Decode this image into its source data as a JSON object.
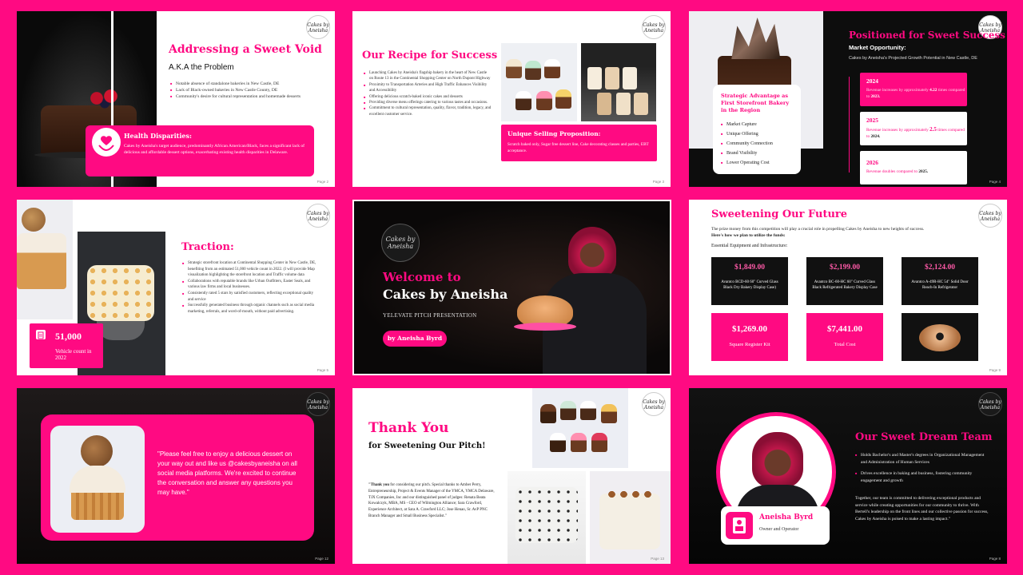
{
  "s1": {
    "title": "Addressing a Sweet Void",
    "subtitle": "A.K.A the Problem",
    "bullets": [
      "Notable absence of standalone bakeries in New Castle, DE",
      "Lack of Black-owned bakeries in New Castle County, DE",
      "Community's desire for cultural representation and homemade desserts"
    ],
    "callout_title": "Health Disparities:",
    "callout_text": "Cakes by Aneisha's target audience, predominantly African American/Black, faces a significant lack of delicious and affordable dessert options, exacerbating existing health disparities in Delaware.",
    "page": "Page 2"
  },
  "s2": {
    "title": "Our Recipe for Success",
    "bullets": [
      "Launching Cakes by Aneisha's flagship bakery in the heart of New Castle on Route 13 in the Continental Shopping Center on North Dupont Highway",
      "Proximity to Transportation Arteries and High Traffic Enhances Visibility and Accessibility",
      "Offering delicious scratch-baked iconic cakes and desserts",
      "Providing diverse menu offerings catering to various tastes and occasions.",
      "Commitment to cultural representation, quality, flavor, tradition, legacy, and excellent customer service."
    ],
    "usp_title": "Unique Selling Proposition:",
    "usp_text": "Scratch baked only, Sugar free dessert line, Cake decorating classes and parties, EBT acceptance.",
    "page": "Page 3"
  },
  "s3": {
    "title": "Positioned for Sweet Success",
    "market": "Market Opportunity:",
    "projection": "Cakes by Aneisha's Projected Growth Potential in New Castle, DE",
    "card_title": "Strategic Advantage as First Storefront Bakery in the Region",
    "card_items": [
      "Market Capture",
      "Unique Offering",
      "Community Connection",
      "Brand Visibility",
      "Lower Operating Cost"
    ],
    "timeline": [
      {
        "year": "2024",
        "pre": "Revenue increases by approximately ",
        "bold": "4.22",
        "post": " times compared to ",
        "ref": "2023."
      },
      {
        "year": "2025",
        "pre": "Revenue increases by approximately ",
        "bold": "2.5",
        "post": " times compared to ",
        "ref": "2024."
      },
      {
        "year": "2026",
        "pre": "Revenue doubles compared to ",
        "bold": "",
        "post": "",
        "ref": "2025."
      }
    ],
    "page": "Page 4"
  },
  "s4": {
    "title": "Traction:",
    "bullets": [
      "Strategic storefront location at Continental Shopping Center in New Castle, DE, benefiting from an estimated 51,000 vehicle count in 2022. (I will provide Map visualization highlighting the storefront location and Traffic volume data",
      "Collaborations with reputable brands like Urban Outfitters, Easter Seals, and various law firms and local businesses.",
      "Consistently rated 5 stars by satisfied customers, reflecting exceptional quality and service",
      "Successfully generated business through organic channels such as social media marketing, referrals, and word-of-mouth, without paid advertising."
    ],
    "stat_value": "51,000",
    "stat_label": "Vehicle count in 2022",
    "page": "Page 5"
  },
  "s5": {
    "welcome": "Welcome to",
    "brand": "Cakes by Aneisha",
    "pitch": "YELEVATE PITCH PRESENTATION",
    "presenter": "by Aneisha Byrd",
    "logo": "Cakes by Aneisha"
  },
  "s6": {
    "title": "Sweetening Our Future",
    "intro": "The prize money from this competition will play a crucial role in propelling Cakes by Aneisha to new heights of success.",
    "intro_bold": "Here's how we plan to utilize the funds:",
    "section": "Essential Equipment and Infrastructure:",
    "items": [
      {
        "price": "$1,849.00",
        "desc": "Avantco BCD-60 60\" Curved Glass Black Dry Bakery Display Case)"
      },
      {
        "price": "$2,199.00",
        "desc": "Avantco BC-60-HC 60\" Curved Glass Black Refrigerated Bakery Display Case"
      },
      {
        "price": "$2,124.00",
        "desc": "Avantco A-49R-HC 54\" Solid Door Reach-In Refrigerator"
      }
    ],
    "register_price": "$1,269.00",
    "register_label": "Square Register Kit",
    "total_price": "$7,441.00",
    "total_label": "Total Cost",
    "page": "Page 9"
  },
  "s7": {
    "quote": "\"Please feel free to enjoy a delicious dessert on your way out and like us @cakesbyaneisha on all social media platforms. We're excited to continue the conversation and answer any questions you may have.\"",
    "page": "Page 12"
  },
  "s8": {
    "title": "Thank You",
    "subtitle": "for Sweetening Our Pitch!",
    "lead": "\"Thank you",
    "body": " for considering our pitch. Special thanks to Amber Perry, Entrepreneurship, Project & Events Manager of the YMCA, YMCA Delaware, TJX Companies, Inc and our distinguished panel of judges: Renata Beata Kowalczyk, MBA, MS - CEO of Wilmington Alliance; Sara Crawford, Experience Architect, at Sara A. Crawford LLC; Jose Henao, Sr. AvP PNC Branch Manager and Small Business Specialist.\"",
    "page": "Page 13"
  },
  "s9": {
    "title": "Our Sweet Dream Team",
    "bullets": [
      "Holds Bachelor's and Master's degrees in Organizational Management and Administration of Human Services",
      "Drives excellence in baking and business, fostering community engagement and growth"
    ],
    "paragraph": "Together, our team is committed to delivering exceptional products and service while creating opportunities for our community to thrive. With Bertell's leadership on the front lines and our collective passion for success, Cakes by Aneisha is poised to make a lasting impact.\"",
    "name": "Aneisha Byrd",
    "role": "Owner and Operator",
    "page": "Page 8"
  },
  "logo_text": "Cakes by Aneisha",
  "colors": {
    "brand": "#ff0a82",
    "dark": "#0d0d0d"
  }
}
